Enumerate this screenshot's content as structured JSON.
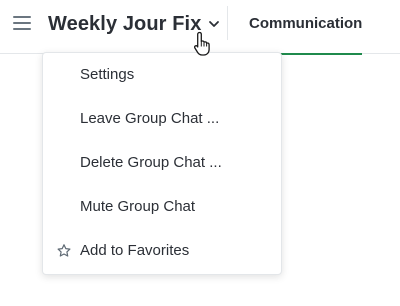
{
  "header": {
    "menu_icon": "hamburger-menu-icon",
    "title": "Weekly Jour Fix",
    "title_dropdown_icon": "chevron-down-icon",
    "tab_label": "Communication",
    "accent_color": "#1f8a4c"
  },
  "dropdown_menu": {
    "items": [
      {
        "label": "Settings",
        "icon": ""
      },
      {
        "label": "Leave Group Chat ...",
        "icon": ""
      },
      {
        "label": "Delete Group Chat ...",
        "icon": ""
      },
      {
        "label": "Mute Group Chat",
        "icon": ""
      },
      {
        "label": "Add to Favorites",
        "icon": "star-outline-icon"
      }
    ]
  },
  "cursor": "hand-pointer-cursor"
}
